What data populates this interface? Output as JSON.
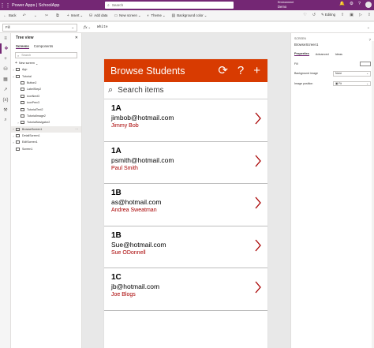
{
  "header": {
    "app_title": "Power Apps  |  SchoolApp",
    "search_placeholder": "Search",
    "environment_label": "Environment",
    "environment_name": "Demo",
    "icons": [
      "waffle-icon",
      "bell-icon",
      "settings-icon",
      "help-icon",
      "avatar"
    ]
  },
  "commands": {
    "back": "Back",
    "undo_icon": "undo-icon",
    "redo_icon": "redo-icon",
    "cut_icon": "cut-icon",
    "copy_icon": "copy-icon",
    "insert": "Insert",
    "add_data": "Add data",
    "new_screen": "New screen",
    "theme": "Theme",
    "background_color": "Background color",
    "editing": "Editing"
  },
  "formula": {
    "property": "Fill",
    "fx": "fx",
    "value": "White"
  },
  "tree": {
    "title": "Tree view",
    "tabs": [
      "Screens",
      "Components"
    ],
    "search_placeholder": "Search",
    "new_screen": "New screen",
    "items": [
      {
        "label": "App",
        "level": 0
      },
      {
        "label": "Tutorial",
        "level": 0
      },
      {
        "label": "Button2",
        "level": 1
      },
      {
        "label": "LabelStep2",
        "level": 1
      },
      {
        "label": "iconNext3",
        "level": 1
      },
      {
        "label": "iconPrev3",
        "level": 1
      },
      {
        "label": "TutorialText2",
        "level": 1
      },
      {
        "label": "TutorialImage2",
        "level": 1
      },
      {
        "label": "TutorialNavigator2",
        "level": 1
      },
      {
        "label": "BrowseScreen1",
        "level": 0,
        "selected": true
      },
      {
        "label": "DetailScreen1",
        "level": 0
      },
      {
        "label": "EditScreen1",
        "level": 0
      },
      {
        "label": "Screen1",
        "level": 0
      }
    ]
  },
  "app": {
    "title": "Browse Students",
    "search_placeholder": "Search items",
    "header_icons": [
      "refresh-icon",
      "sort-icon",
      "add-icon"
    ],
    "accent": "#d83b01",
    "body_color": "#a80000",
    "items": [
      {
        "title": "1A",
        "subtitle": "jimbob@hotmail.com",
        "body": "Jimmy Bob"
      },
      {
        "title": "1A",
        "subtitle": "psmith@hotmail.com",
        "body": "Paul Smith"
      },
      {
        "title": "1B",
        "subtitle": "as@hotmail.com",
        "body": "Andrea Sweatman"
      },
      {
        "title": "1B",
        "subtitle": "Sue@hotmail.com",
        "body": "Sue ODonnell"
      },
      {
        "title": "1C",
        "subtitle": "jb@hotmail.com",
        "body": "Joe Blogs"
      }
    ]
  },
  "properties": {
    "kind": "SCREEN",
    "name": "BrowseScreen1",
    "tabs": [
      "Properties",
      "Advanced",
      "Ideas"
    ],
    "fill_label": "Fill",
    "bg_image_label": "Background image",
    "bg_image_value": "None",
    "image_position_label": "Image position",
    "image_position_value": "Fit"
  },
  "colors": {
    "brand": "#742774",
    "app_header": "#d83b01"
  }
}
